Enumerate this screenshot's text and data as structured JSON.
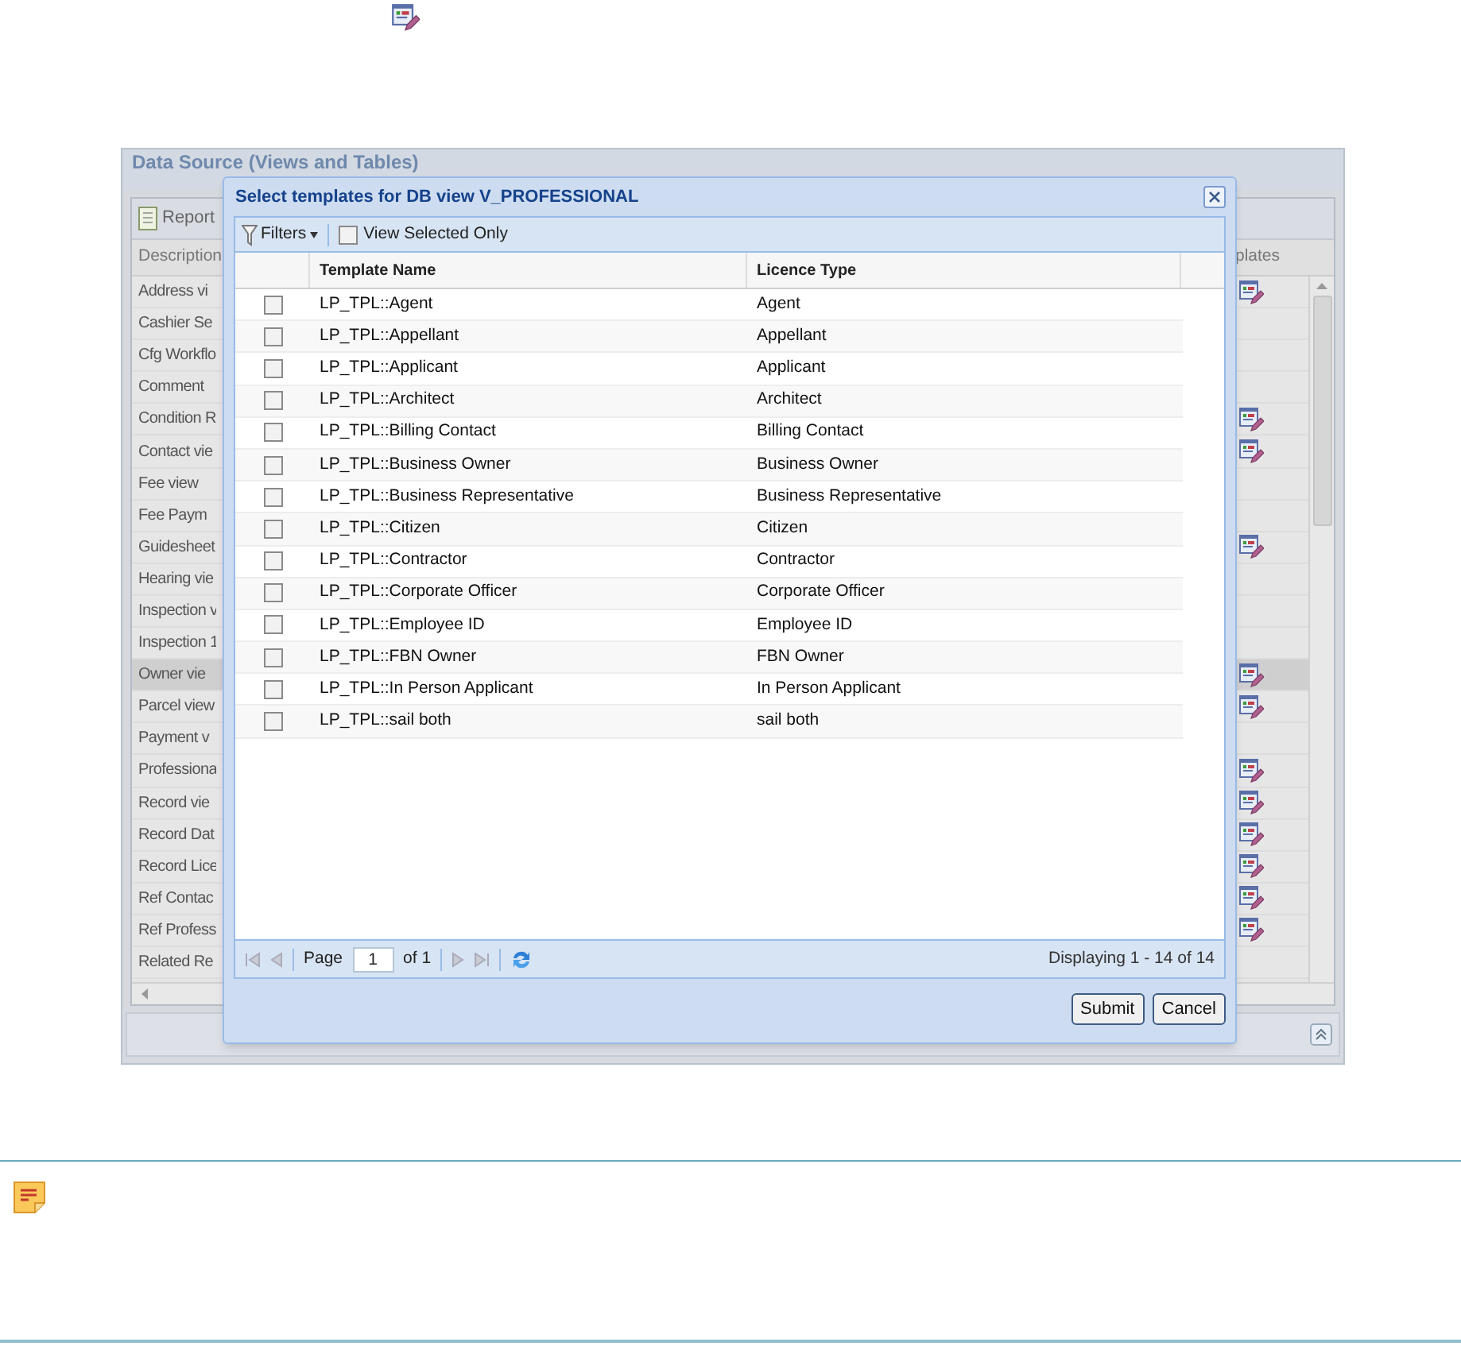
{
  "panel": {
    "title": "Data Source (Views and Tables)",
    "toolbar_button": "Report",
    "columns": [
      "Description",
      "plates"
    ],
    "rows": [
      {
        "description": "Address vi",
        "has_templates": true,
        "selected": false
      },
      {
        "description": "Cashier Se",
        "has_templates": false,
        "selected": false
      },
      {
        "description": "Cfg Workflo",
        "has_templates": false,
        "selected": false
      },
      {
        "description": "Comment",
        "has_templates": false,
        "selected": false
      },
      {
        "description": "Condition R",
        "has_templates": true,
        "selected": false
      },
      {
        "description": "Contact vie",
        "has_templates": true,
        "selected": false
      },
      {
        "description": "Fee view",
        "has_templates": false,
        "selected": false
      },
      {
        "description": "Fee Paym",
        "has_templates": false,
        "selected": false
      },
      {
        "description": "Guidesheet",
        "has_templates": true,
        "selected": false
      },
      {
        "description": "Hearing vie",
        "has_templates": false,
        "selected": false
      },
      {
        "description": "Inspection v",
        "has_templates": false,
        "selected": false
      },
      {
        "description": "Inspection 1",
        "has_templates": false,
        "selected": false
      },
      {
        "description": "Owner vie",
        "has_templates": true,
        "selected": true
      },
      {
        "description": "Parcel view",
        "has_templates": true,
        "selected": false
      },
      {
        "description": "Payment v",
        "has_templates": false,
        "selected": false
      },
      {
        "description": "Professiona",
        "has_templates": true,
        "selected": false
      },
      {
        "description": "Record vie",
        "has_templates": true,
        "selected": false
      },
      {
        "description": "Record Dat",
        "has_templates": true,
        "selected": false
      },
      {
        "description": "Record Lice",
        "has_templates": true,
        "selected": false
      },
      {
        "description": "Ref Contac",
        "has_templates": true,
        "selected": false
      },
      {
        "description": "Ref Profess",
        "has_templates": true,
        "selected": false
      },
      {
        "description": "Related Re",
        "has_templates": false,
        "selected": false
      }
    ]
  },
  "dialog": {
    "title": "Select templates for DB view V_PROFESSIONAL",
    "filters": "Filters",
    "view_selected_only": {
      "label": "View Selected Only",
      "checked": false
    },
    "columns": [
      "Template Name",
      "Licence Type"
    ],
    "rows": [
      {
        "template_name": "LP_TPL::Agent",
        "licence_type": "Agent",
        "checked": false
      },
      {
        "template_name": "LP_TPL::Appellant",
        "licence_type": "Appellant",
        "checked": false
      },
      {
        "template_name": "LP_TPL::Applicant",
        "licence_type": "Applicant",
        "checked": false
      },
      {
        "template_name": "LP_TPL::Architect",
        "licence_type": "Architect",
        "checked": false
      },
      {
        "template_name": "LP_TPL::Billing Contact",
        "licence_type": "Billing Contact",
        "checked": false
      },
      {
        "template_name": "LP_TPL::Business Owner",
        "licence_type": "Business Owner",
        "checked": false
      },
      {
        "template_name": "LP_TPL::Business Representative",
        "licence_type": "Business Representative",
        "checked": false
      },
      {
        "template_name": "LP_TPL::Citizen",
        "licence_type": "Citizen",
        "checked": false
      },
      {
        "template_name": "LP_TPL::Contractor",
        "licence_type": "Contractor",
        "checked": false
      },
      {
        "template_name": "LP_TPL::Corporate Officer",
        "licence_type": "Corporate Officer",
        "checked": false
      },
      {
        "template_name": "LP_TPL::Employee ID",
        "licence_type": "Employee ID",
        "checked": false
      },
      {
        "template_name": "LP_TPL::FBN Owner",
        "licence_type": "FBN Owner",
        "checked": false
      },
      {
        "template_name": "LP_TPL::In Person Applicant",
        "licence_type": "In Person Applicant",
        "checked": false
      },
      {
        "template_name": "LP_TPL::sail both",
        "licence_type": "sail both",
        "checked": false
      }
    ],
    "paging": {
      "before": "Page",
      "page": "1",
      "after": "of 1",
      "display": "Displaying 1 - 14 of 14"
    },
    "buttons": [
      "Submit",
      "Cancel"
    ]
  }
}
